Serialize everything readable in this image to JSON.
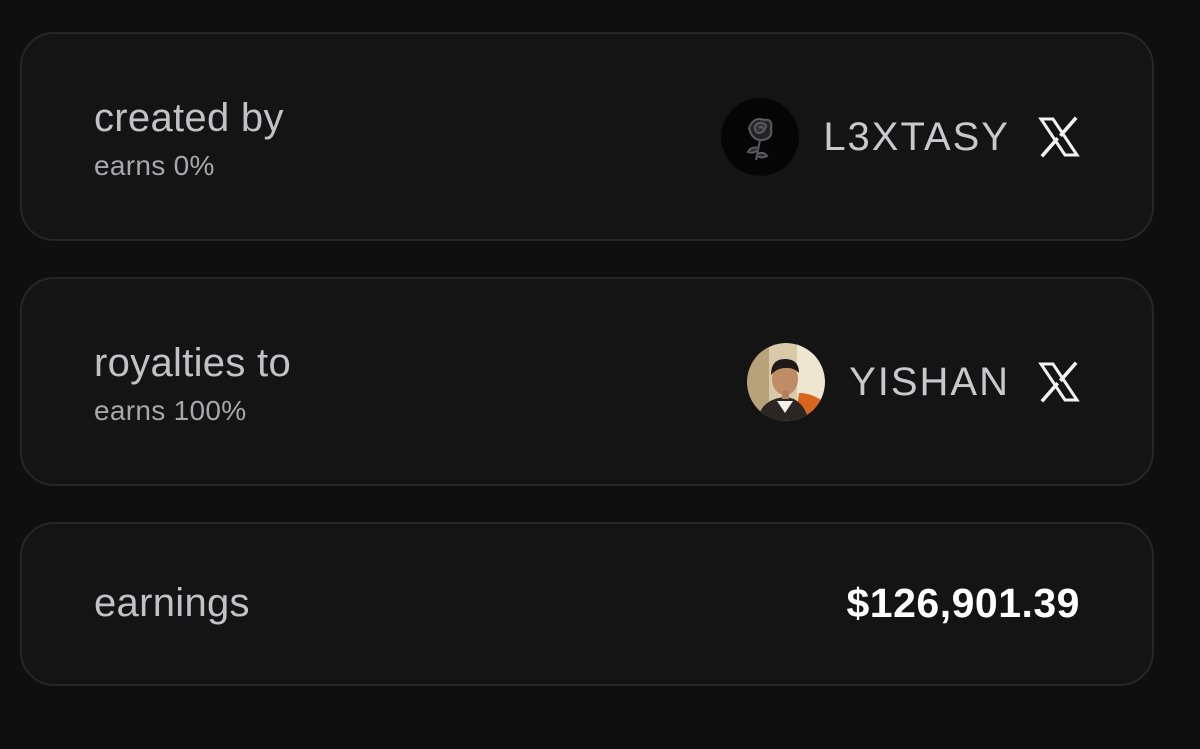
{
  "creator": {
    "title": "created by",
    "subtitle": "earns 0%",
    "username": "L3XTASY",
    "avatar_icon": "rose-avatar",
    "social_icon": "x-logo-icon"
  },
  "royalties": {
    "title": "royalties to",
    "subtitle": "earns 100%",
    "username": "YISHAN",
    "avatar_icon": "profile-photo-avatar",
    "social_icon": "x-logo-icon"
  },
  "earnings": {
    "title": "earnings",
    "amount": "$126,901.39"
  },
  "colors": {
    "background": "#0f0f10",
    "card": "#141415",
    "border": "#262628",
    "text_primary": "#c2c2c4",
    "text_secondary": "#a8a8aa",
    "amount": "#ffffff"
  }
}
